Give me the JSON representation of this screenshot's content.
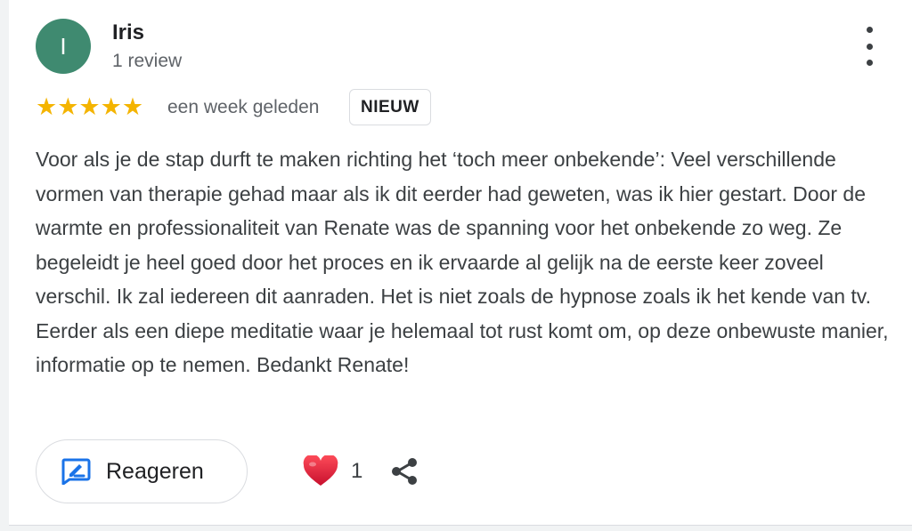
{
  "review": {
    "avatar_initial": "I",
    "avatar_color": "#3f8a70",
    "reviewer_name": "Iris",
    "review_count": "1 review",
    "rating": 5,
    "stars_text": "★★★★★",
    "star_color": "#f4b400",
    "date": "een week geleden",
    "badge": "NIEUW",
    "text": "Voor als je de stap durft te maken richting het ‘toch meer onbekende’: Veel verschillende vormen van therapie gehad maar als ik dit eerder had geweten, was ik hier gestart. Door de warmte en professionaliteit van Renate was de spanning voor het onbekende zo weg. Ze begeleidt je heel goed door het proces en ik ervaarde al gelijk na de eerste keer zoveel verschil. Ik zal iedereen dit aanraden. Het is niet zoals de hypnose zoals ik het kende van tv. Eerder als een diepe meditatie waar je helemaal tot rust komt om, op deze onbewuste manier, informatie op te nemen. Bedankt Renate!"
  },
  "actions": {
    "reply_label": "Reageren",
    "reply_icon": "reply-icon",
    "like_icon": "heart-icon",
    "like_count": "1",
    "share_icon": "share-icon",
    "more_icon": "more-vertical-icon",
    "accent_color": "#1a73e8"
  }
}
